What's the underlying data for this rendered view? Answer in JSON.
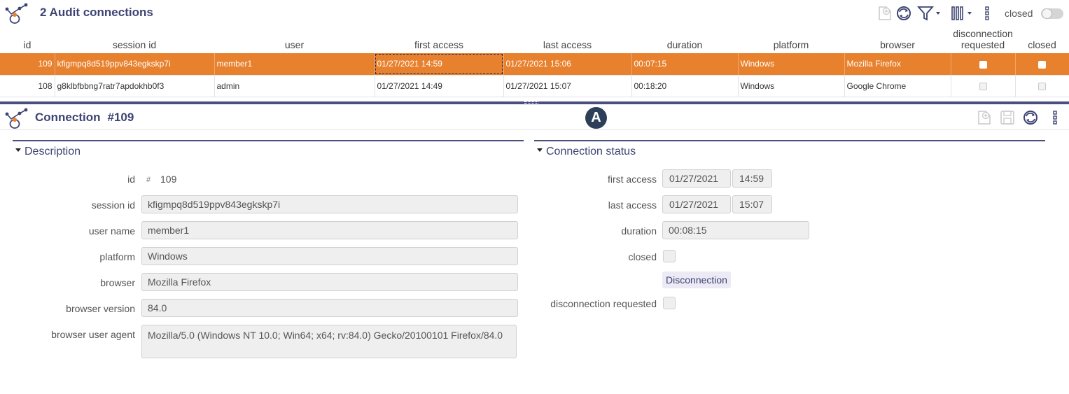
{
  "list": {
    "title": "2 Audit connections",
    "closed_toggle_label": "closed",
    "columns": {
      "id": "id",
      "session_id": "session id",
      "user": "user",
      "first_access": "first access",
      "last_access": "last access",
      "duration": "duration",
      "platform": "platform",
      "browser": "browser",
      "disconnection_requested_1": "disconnection",
      "disconnection_requested_2": "requested",
      "closed": "closed"
    },
    "rows": [
      {
        "id": "109",
        "session_id": "kfigmpq8d519ppv843egkskp7i",
        "user": "member1",
        "first_access": "01/27/2021 14:59",
        "last_access": "01/27/2021 15:06",
        "duration": "00:07:15",
        "platform": "Windows",
        "browser": "Mozilla Firefox",
        "disconnection_requested": false,
        "closed": false,
        "selected": true
      },
      {
        "id": "108",
        "session_id": "g8klbfbbng7ratr7apdokhb0f3",
        "user": "admin",
        "first_access": "01/27/2021 14:49",
        "last_access": "01/27/2021 15:07",
        "duration": "00:18:20",
        "platform": "Windows",
        "browser": "Google Chrome",
        "disconnection_requested": false,
        "closed": false,
        "selected": false
      }
    ]
  },
  "form": {
    "title": "Connection",
    "record": "#109",
    "badge": "A",
    "description": {
      "title": "Description",
      "id_label": "id",
      "id_hash": "#",
      "id_value": "109",
      "session_id_label": "session id",
      "session_id_value": "kfigmpq8d519ppv843egkskp7i",
      "user_name_label": "user name",
      "user_name_value": "member1",
      "platform_label": "platform",
      "platform_value": "Windows",
      "browser_label": "browser",
      "browser_value": "Mozilla Firefox",
      "browser_version_label": "browser version",
      "browser_version_value": "84.0",
      "user_agent_label": "browser user agent",
      "user_agent_value": "Mozilla/5.0 (Windows NT 10.0; Win64; x64; rv:84.0) Gecko/20100101 Firefox/84.0"
    },
    "status": {
      "title": "Connection status",
      "first_access_label": "first access",
      "first_access_date": "01/27/2021",
      "first_access_time": "14:59",
      "last_access_label": "last access",
      "last_access_date": "01/27/2021",
      "last_access_time": "15:07",
      "duration_label": "duration",
      "duration_value": "00:08:15",
      "closed_label": "closed",
      "disconnection_button": "Disconnection",
      "disconnection_requested_label": "disconnection requested"
    }
  },
  "colors": {
    "accent": "#e8812e",
    "brand": "#3d4473",
    "badge": "#2c3e58"
  }
}
